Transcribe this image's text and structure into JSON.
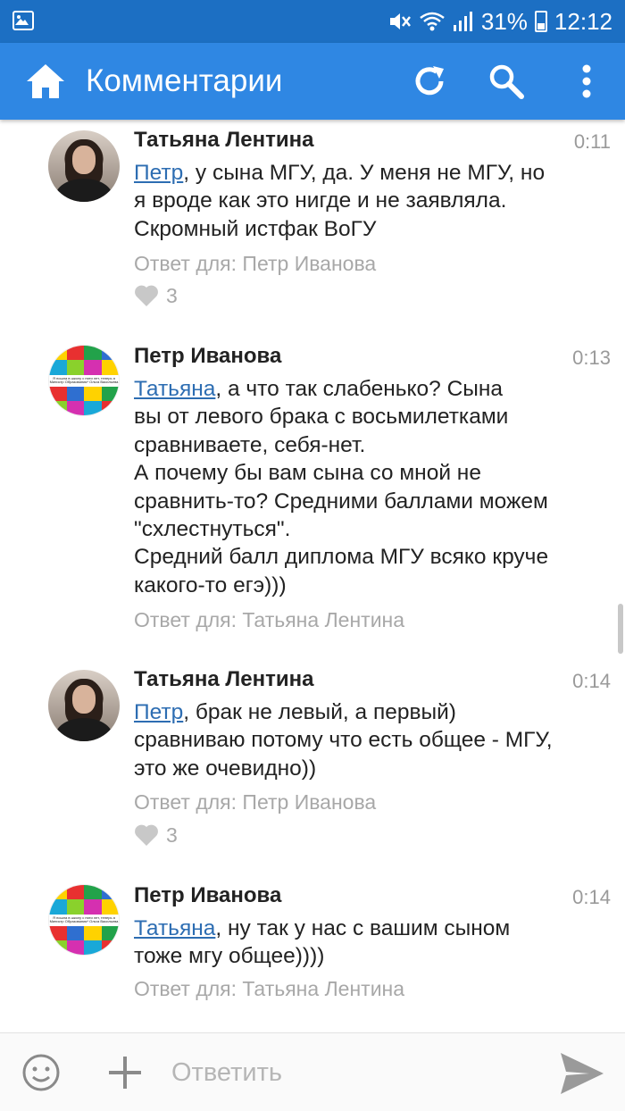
{
  "status_bar": {
    "battery": "31%",
    "time": "12:12",
    "icons": [
      "image-icon",
      "mute-icon",
      "wifi-icon",
      "signal-icon",
      "battery-icon"
    ]
  },
  "app_bar": {
    "title": "Комментарии",
    "icons": [
      "home-icon",
      "refresh-icon",
      "search-icon",
      "more-icon"
    ],
    "color": "#2f87e3"
  },
  "comments": [
    {
      "author": "Татьяна Лентина",
      "time": "0:11",
      "mention": "Петр",
      "lines": [
        ", у сына МГУ, да. У меня не МГУ, но",
        "я вроде как это нигде и не заявляла.",
        "Скромный истфак ВоГУ"
      ],
      "reply_to": "Ответ для: Петр Иванова",
      "likes": "3"
    },
    {
      "author": "Петр Иванова",
      "time": "0:13",
      "mention": "Татьяна",
      "lines": [
        ", а что так слабенько? Сына",
        "вы от левого брака с восьмилетками",
        "сравниваете, себя-нет.",
        "А почему бы вам сына со мной не",
        "сравнить-то? Средними баллами можем",
        "\"схлестнуться\".",
        "Средний балл диплома МГУ всяко круче",
        "какого-то егэ)))"
      ],
      "reply_to": "Ответ для: Татьяна Лентина"
    },
    {
      "author": "Татьяна Лентина",
      "time": "0:14",
      "mention": "Петр",
      "lines": [
        ", брак не левый, а первый)",
        "сравниваю потому что есть общее - МГУ,",
        "это же очевидно))"
      ],
      "reply_to": "Ответ для: Петр Иванова",
      "likes": "3"
    },
    {
      "author": "Петр Иванова",
      "time": "0:14",
      "mention": "Татьяна",
      "lines": [
        ", ну так у нас с вашим сыном",
        "тоже мгу общее))))"
      ],
      "reply_to": "Ответ для: Татьяна Лентина"
    }
  ],
  "avatar_text": "Я пошла в школу с пяти лет, теперь я Министр Образования* Ольга Васильева",
  "composer": {
    "placeholder": "Ответить",
    "icons": [
      "emoji-icon",
      "plus-icon",
      "send-icon"
    ]
  }
}
